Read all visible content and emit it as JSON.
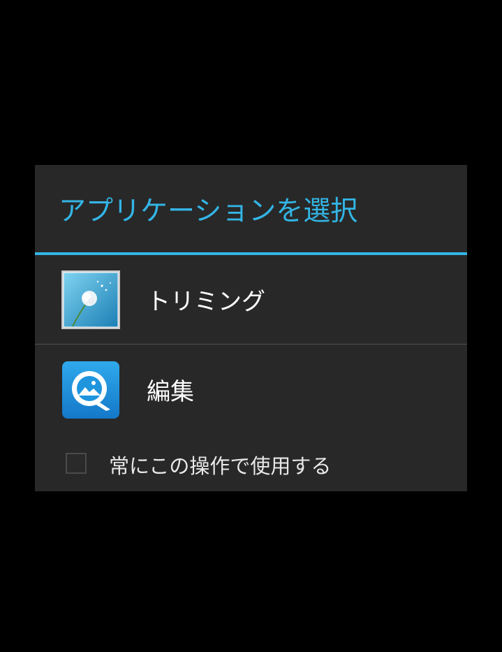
{
  "dialog": {
    "title": "アプリケーションを選択",
    "accent_color": "#33b5e5",
    "apps": [
      {
        "label": "トリミング",
        "icon": "dandelion-photo-icon"
      },
      {
        "label": "編集",
        "icon": "quickpic-q-icon"
      }
    ],
    "always_use": {
      "label": "常にこの操作で使用する",
      "checked": false
    }
  }
}
